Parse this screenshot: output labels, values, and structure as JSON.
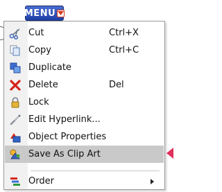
{
  "menu_button": {
    "label": "MENU"
  },
  "menu": {
    "items": [
      {
        "label": "Cut",
        "shortcut": "Ctrl+X",
        "icon": "scissors-icon"
      },
      {
        "label": "Copy",
        "shortcut": "Ctrl+C",
        "icon": "copy-icon"
      },
      {
        "label": "Duplicate",
        "shortcut": "",
        "icon": "duplicate-icon"
      },
      {
        "label": "Delete",
        "shortcut": "Del",
        "icon": "delete-icon"
      },
      {
        "label": "Lock",
        "shortcut": "",
        "icon": "lock-icon"
      },
      {
        "label": "Edit Hyperlink...",
        "shortcut": "",
        "icon": "hyperlink-icon"
      },
      {
        "label": "Object Properties",
        "shortcut": "",
        "icon": "properties-icon"
      },
      {
        "label": "Save As Clip Art",
        "shortcut": "",
        "icon": "clip-art-icon",
        "selected": true
      },
      {
        "label": "Order",
        "shortcut": "",
        "icon": "order-icon",
        "submenu": true
      }
    ]
  },
  "colors": {
    "menu_button_bg": "#2446b5",
    "selected_bg": "#c9c9c9",
    "pointer": "#e0305a"
  }
}
